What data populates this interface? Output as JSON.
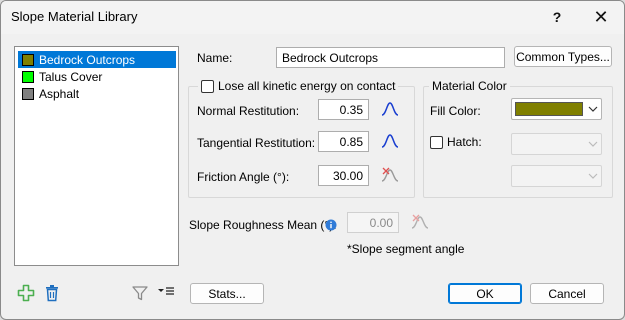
{
  "window": {
    "title": "Slope Material Library",
    "help_glyph": "?",
    "close_glyph": "✕"
  },
  "materials": [
    {
      "label": "Bedrock Outcrops",
      "color": "#808000",
      "selected": true
    },
    {
      "label": "Talus Cover",
      "color": "#00ff00",
      "selected": false
    },
    {
      "label": "Asphalt",
      "color": "#808080",
      "selected": false
    }
  ],
  "name_field": {
    "label": "Name:",
    "value": "Bedrock Outcrops",
    "common_types_button": "Common Types..."
  },
  "energy_group": {
    "lose_energy_label": "Lose all kinetic energy on contact",
    "lose_energy_checked": false,
    "normal_restitution_label": "Normal Restitution:",
    "normal_restitution_value": "0.35",
    "tangential_restitution_label": "Tangential Restitution:",
    "tangential_restitution_value": "0.85",
    "friction_angle_label": "Friction Angle (°):",
    "friction_angle_value": "30.00"
  },
  "material_color_group": {
    "title": "Material Color",
    "fill_color_label": "Fill Color:",
    "fill_color": "#808000",
    "hatch_label": "Hatch:",
    "hatch_checked": false
  },
  "roughness": {
    "label": "Slope Roughness Mean (°):",
    "value": "0.00",
    "note": "*Slope segment angle"
  },
  "footer": {
    "stats_button": "Stats...",
    "ok_button": "OK",
    "cancel_button": "Cancel"
  },
  "colors": {
    "accent": "#0078d7",
    "add_icon": "#4caf50",
    "delete_icon": "#1f6fbf",
    "distribution_icon": "#1a3fd0",
    "info_icon": "#2f7bd8"
  }
}
